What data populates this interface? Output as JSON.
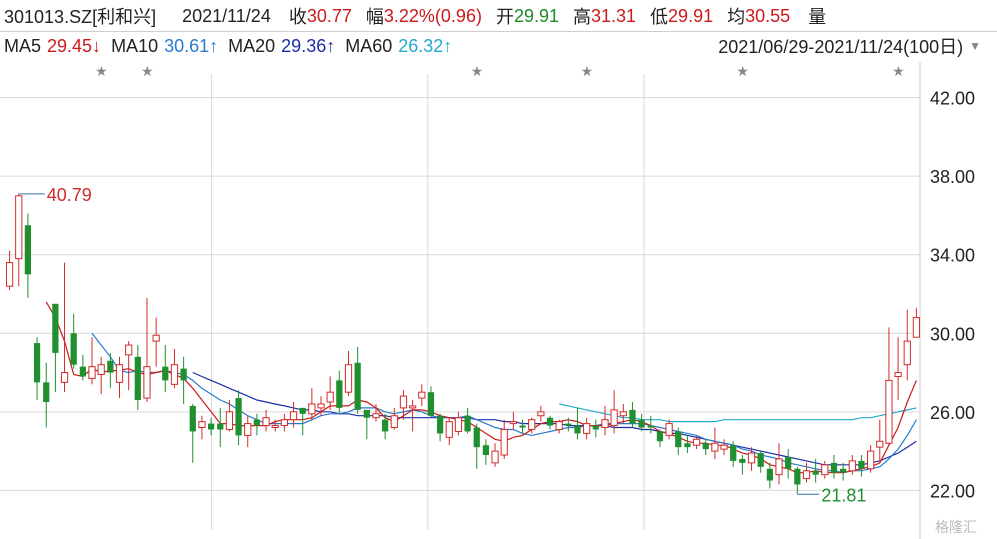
{
  "header": {
    "code_name": "301013.SZ[利和兴]",
    "date": "2021/11/24",
    "close_label": "收",
    "close_value": "30.77",
    "change_label": "幅",
    "change_value": "3.22%(0.96)",
    "open_label": "开",
    "open_value": "29.91",
    "high_label": "高",
    "high_value": "31.31",
    "low_label": "低",
    "low_value": "29.91",
    "avg_label": "均",
    "avg_value": "30.55",
    "volume_label": "量"
  },
  "ma_bar": {
    "ma5_label": "MA5",
    "ma5_value": "29.45↓",
    "ma10_label": "MA10",
    "ma10_value": "30.61↑",
    "ma20_label": "MA20",
    "ma20_value": "29.36↑",
    "ma60_label": "MA60",
    "ma60_value": "26.32↑",
    "range": "2021/06/29-2021/11/24(100日)",
    "range_icon": "triangle-down-icon"
  },
  "colors": {
    "up": "#d42a2a",
    "down": "#1f8f2f",
    "ma5": "#cc1a1a",
    "ma10": "#2a7ad0",
    "ma20": "#1c2fa8",
    "ma60": "#22aacc",
    "grid": "#d9d9d9"
  },
  "chart_data": {
    "type": "candlestick",
    "ylim": [
      21.0,
      43.0
    ],
    "y_ticks": [
      "42.00",
      "38.00",
      "34.00",
      "30.00",
      "26.00",
      "22.00"
    ],
    "y_tick_values": [
      42,
      38,
      34,
      30,
      26,
      22
    ],
    "max_label": "40.79",
    "min_label": "21.81",
    "candles": [
      [
        32.4,
        33.6,
        32.2,
        34.2
      ],
      [
        33.8,
        37.0,
        32.4,
        37.1
      ],
      [
        35.5,
        33.0,
        31.8,
        36.1
      ],
      [
        29.5,
        27.5,
        26.6,
        29.8
      ],
      [
        27.5,
        26.5,
        25.2,
        28.5
      ],
      [
        31.5,
        29.0,
        27.0,
        31.5
      ],
      [
        27.5,
        28.0,
        27.0,
        33.6
      ],
      [
        30.0,
        28.4,
        28.2,
        31.0
      ],
      [
        28.3,
        27.8,
        27.6,
        28.9
      ],
      [
        27.7,
        28.3,
        27.4,
        29.8
      ],
      [
        27.9,
        28.4,
        26.9,
        28.8
      ],
      [
        28.6,
        28.0,
        27.2,
        29.0
      ],
      [
        27.5,
        28.4,
        26.7,
        28.8
      ],
      [
        28.9,
        29.4,
        27.1,
        29.6
      ],
      [
        28.8,
        26.6,
        26.1,
        29.4
      ],
      [
        26.7,
        28.3,
        26.5,
        31.8
      ],
      [
        29.6,
        29.9,
        28.3,
        30.8
      ],
      [
        28.3,
        27.6,
        27.0,
        29.4
      ],
      [
        27.4,
        28.4,
        27.2,
        29.2
      ],
      [
        28.2,
        27.6,
        26.4,
        28.8
      ],
      [
        26.3,
        25.0,
        23.4,
        26.4
      ],
      [
        25.2,
        25.5,
        24.6,
        25.8
      ],
      [
        25.4,
        25.1,
        24.8,
        25.7
      ],
      [
        25.4,
        25.1,
        24.2,
        26.2
      ],
      [
        25.1,
        26.0,
        25.0,
        26.6
      ],
      [
        26.7,
        24.8,
        24.3,
        27.1
      ],
      [
        24.8,
        25.4,
        24.2,
        25.8
      ],
      [
        25.6,
        25.3,
        24.8,
        25.9
      ],
      [
        25.3,
        25.7,
        25.0,
        26.1
      ],
      [
        25.2,
        25.3,
        25.0,
        25.6
      ],
      [
        25.3,
        25.6,
        25.0,
        25.9
      ],
      [
        25.6,
        26.0,
        25.2,
        26.5
      ],
      [
        26.2,
        25.9,
        24.8,
        26.2
      ],
      [
        25.9,
        26.4,
        25.6,
        27.2
      ],
      [
        26.2,
        26.4,
        25.8,
        26.8
      ],
      [
        26.5,
        27.0,
        26.1,
        27.8
      ],
      [
        27.6,
        26.2,
        25.9,
        28.1
      ],
      [
        27.0,
        28.4,
        26.8,
        29.1
      ],
      [
        28.5,
        26.1,
        25.9,
        29.3
      ],
      [
        26.1,
        25.7,
        24.6,
        26.1
      ],
      [
        25.7,
        25.9,
        25.5,
        26.4
      ],
      [
        25.6,
        25.0,
        24.6,
        25.9
      ],
      [
        25.2,
        25.8,
        25.1,
        26.2
      ],
      [
        26.2,
        26.8,
        25.6,
        27.1
      ],
      [
        26.2,
        26.3,
        25.0,
        26.6
      ],
      [
        26.7,
        27.0,
        26.3,
        27.4
      ],
      [
        27.0,
        25.8,
        25.7,
        27.3
      ],
      [
        25.8,
        24.9,
        24.5,
        25.9
      ],
      [
        24.7,
        25.5,
        24.3,
        25.7
      ],
      [
        25.0,
        25.7,
        24.8,
        26.0
      ],
      [
        25.8,
        25.0,
        24.9,
        26.2
      ],
      [
        25.2,
        24.2,
        23.1,
        25.4
      ],
      [
        24.3,
        23.8,
        23.3,
        24.6
      ],
      [
        23.4,
        24.0,
        23.2,
        24.4
      ],
      [
        23.8,
        25.1,
        23.6,
        25.6
      ],
      [
        25.4,
        25.5,
        25.1,
        26.0
      ],
      [
        25.3,
        25.2,
        24.9,
        25.6
      ],
      [
        25.1,
        25.6,
        24.9,
        25.7
      ],
      [
        25.8,
        26.0,
        25.5,
        26.3
      ],
      [
        25.7,
        25.3,
        25.1,
        25.8
      ],
      [
        25.1,
        25.5,
        24.9,
        25.6
      ],
      [
        25.4,
        25.3,
        25.0,
        25.7
      ],
      [
        25.3,
        24.9,
        24.6,
        26.2
      ],
      [
        24.9,
        25.4,
        24.6,
        25.7
      ],
      [
        25.3,
        25.1,
        24.7,
        25.6
      ],
      [
        25.2,
        25.6,
        24.8,
        26.3
      ],
      [
        25.3,
        26.1,
        24.9,
        27.1
      ],
      [
        25.8,
        26.0,
        25.4,
        26.4
      ],
      [
        26.1,
        25.4,
        25.2,
        26.5
      ],
      [
        25.6,
        25.2,
        25.0,
        25.9
      ],
      [
        25.3,
        25.2,
        24.9,
        25.8
      ],
      [
        25.0,
        24.5,
        24.2,
        25.1
      ],
      [
        24.8,
        25.4,
        24.6,
        25.6
      ],
      [
        25.0,
        24.2,
        23.8,
        25.2
      ],
      [
        24.4,
        24.2,
        23.9,
        24.8
      ],
      [
        24.3,
        24.6,
        24.1,
        24.8
      ],
      [
        24.4,
        24.1,
        23.8,
        24.6
      ],
      [
        24.0,
        24.4,
        23.6,
        25.2
      ],
      [
        24.1,
        24.3,
        23.8,
        24.6
      ],
      [
        24.3,
        23.5,
        23.2,
        24.5
      ],
      [
        23.6,
        23.4,
        22.8,
        23.8
      ],
      [
        23.4,
        23.9,
        23.0,
        24.2
      ],
      [
        23.9,
        23.2,
        22.9,
        24.0
      ],
      [
        23.1,
        22.5,
        22.1,
        23.4
      ],
      [
        22.8,
        23.6,
        22.3,
        24.4
      ],
      [
        23.7,
        23.1,
        22.6,
        24.1
      ],
      [
        23.1,
        22.3,
        21.8,
        23.2
      ],
      [
        22.6,
        23.0,
        22.4,
        23.4
      ],
      [
        23.0,
        22.8,
        22.4,
        23.6
      ],
      [
        22.8,
        23.3,
        22.6,
        23.5
      ],
      [
        23.4,
        22.9,
        22.6,
        23.8
      ],
      [
        23.1,
        22.9,
        22.5,
        23.4
      ],
      [
        23.0,
        23.5,
        22.8,
        23.8
      ],
      [
        23.5,
        23.1,
        22.7,
        23.8
      ],
      [
        23.1,
        24.0,
        22.9,
        24.3
      ],
      [
        24.2,
        24.5,
        23.4,
        25.6
      ],
      [
        24.4,
        27.6,
        24.3,
        30.3
      ],
      [
        27.8,
        28.0,
        26.6,
        29.8
      ],
      [
        28.4,
        29.6,
        27.6,
        31.2
      ],
      [
        29.8,
        30.8,
        29.9,
        31.3
      ]
    ],
    "ma5": [
      null,
      null,
      null,
      null,
      31.6,
      30.8,
      29.6,
      27.9,
      27.8,
      28.2,
      28.0,
      28.1,
      28.1,
      28.2,
      28.0,
      27.9,
      28.0,
      28.1,
      27.9,
      27.7,
      27.2,
      26.6,
      26.0,
      25.4,
      25.4,
      25.3,
      25.3,
      25.3,
      25.3,
      25.5,
      25.6,
      25.6,
      25.6,
      25.7,
      26.0,
      26.3,
      26.3,
      26.3,
      26.6,
      26.5,
      26.2,
      25.7,
      25.5,
      25.8,
      26.1,
      26.1,
      26.0,
      25.8,
      25.7,
      25.6,
      25.5,
      25.2,
      24.9,
      24.6,
      24.5,
      24.7,
      24.8,
      25.1,
      25.4,
      25.5,
      25.5,
      25.6,
      25.5,
      25.3,
      25.3,
      25.3,
      25.4,
      25.5,
      25.6,
      25.5,
      25.3,
      25.0,
      24.9,
      24.7,
      24.5,
      24.4,
      24.4,
      24.3,
      24.3,
      24.1,
      23.9,
      23.8,
      23.6,
      23.3,
      23.2,
      23.1,
      22.9,
      22.9,
      23.0,
      22.9,
      22.9,
      22.9,
      23.0,
      23.1,
      23.2,
      23.4,
      24.3,
      25.2,
      26.5,
      27.6
    ],
    "ma10": [
      null,
      null,
      null,
      null,
      null,
      null,
      null,
      null,
      null,
      30.0,
      29.4,
      28.8,
      28.1,
      28.0,
      28.1,
      28.0,
      28.0,
      28.1,
      28.0,
      27.9,
      27.6,
      27.2,
      26.9,
      26.6,
      26.4,
      26.1,
      25.8,
      25.6,
      25.4,
      25.4,
      25.4,
      25.4,
      25.4,
      25.6,
      25.8,
      25.9,
      25.9,
      26.0,
      26.2,
      26.2,
      26.2,
      26.0,
      25.9,
      26.0,
      26.1,
      26.0,
      25.8,
      25.7,
      25.7,
      25.7,
      25.8,
      25.6,
      25.4,
      25.2,
      25.1,
      25.1,
      24.9,
      24.8,
      24.9,
      25.0,
      25.1,
      25.2,
      25.2,
      25.3,
      25.3,
      25.4,
      25.4,
      25.4,
      25.4,
      25.4,
      25.3,
      25.2,
      25.1,
      25.0,
      24.9,
      24.8,
      24.6,
      24.5,
      24.4,
      24.3,
      24.1,
      24.0,
      23.8,
      23.7,
      23.6,
      23.4,
      23.3,
      23.2,
      23.1,
      23.0,
      23.0,
      22.9,
      23.0,
      23.0,
      23.1,
      23.2,
      23.6,
      24.1,
      24.8,
      25.6
    ],
    "ma20": [
      null,
      null,
      null,
      null,
      null,
      null,
      null,
      null,
      null,
      null,
      null,
      null,
      null,
      null,
      null,
      null,
      null,
      null,
      null,
      null,
      28.0,
      27.8,
      27.6,
      27.4,
      27.2,
      27.0,
      26.8,
      26.6,
      26.5,
      26.4,
      26.3,
      26.2,
      26.1,
      26.1,
      26.0,
      26.0,
      25.9,
      25.9,
      25.8,
      25.8,
      25.8,
      25.8,
      25.7,
      25.7,
      25.7,
      25.7,
      25.7,
      25.7,
      25.7,
      25.7,
      25.7,
      25.6,
      25.6,
      25.6,
      25.5,
      25.5,
      25.4,
      25.4,
      25.4,
      25.4,
      25.4,
      25.3,
      25.3,
      25.3,
      25.3,
      25.3,
      25.2,
      25.2,
      25.2,
      25.1,
      25.1,
      25.0,
      24.9,
      24.9,
      24.8,
      24.7,
      24.6,
      24.5,
      24.4,
      24.3,
      24.2,
      24.1,
      24.0,
      23.9,
      23.8,
      23.7,
      23.6,
      23.5,
      23.4,
      23.3,
      23.3,
      23.3,
      23.3,
      23.3,
      23.4,
      23.5,
      23.7,
      23.9,
      24.2,
      24.5
    ],
    "ma60": [
      null,
      null,
      null,
      null,
      null,
      null,
      null,
      null,
      null,
      null,
      null,
      null,
      null,
      null,
      null,
      null,
      null,
      null,
      null,
      null,
      null,
      null,
      null,
      null,
      null,
      null,
      null,
      null,
      null,
      null,
      null,
      null,
      null,
      null,
      null,
      null,
      null,
      null,
      null,
      null,
      null,
      null,
      null,
      null,
      null,
      null,
      null,
      null,
      null,
      null,
      null,
      null,
      null,
      null,
      null,
      null,
      null,
      null,
      null,
      null,
      26.4,
      26.3,
      26.2,
      26.1,
      26.0,
      25.9,
      25.8,
      25.7,
      25.7,
      25.6,
      25.6,
      25.6,
      25.5,
      25.5,
      25.5,
      25.5,
      25.5,
      25.5,
      25.6,
      25.6,
      25.6,
      25.6,
      25.6,
      25.6,
      25.6,
      25.6,
      25.6,
      25.6,
      25.6,
      25.6,
      25.6,
      25.6,
      25.6,
      25.7,
      25.7,
      25.8,
      25.9,
      26.0,
      26.1,
      26.2
    ],
    "star_indices": [
      10,
      15,
      51,
      63,
      80,
      97
    ]
  },
  "watermark": "格隆汇"
}
